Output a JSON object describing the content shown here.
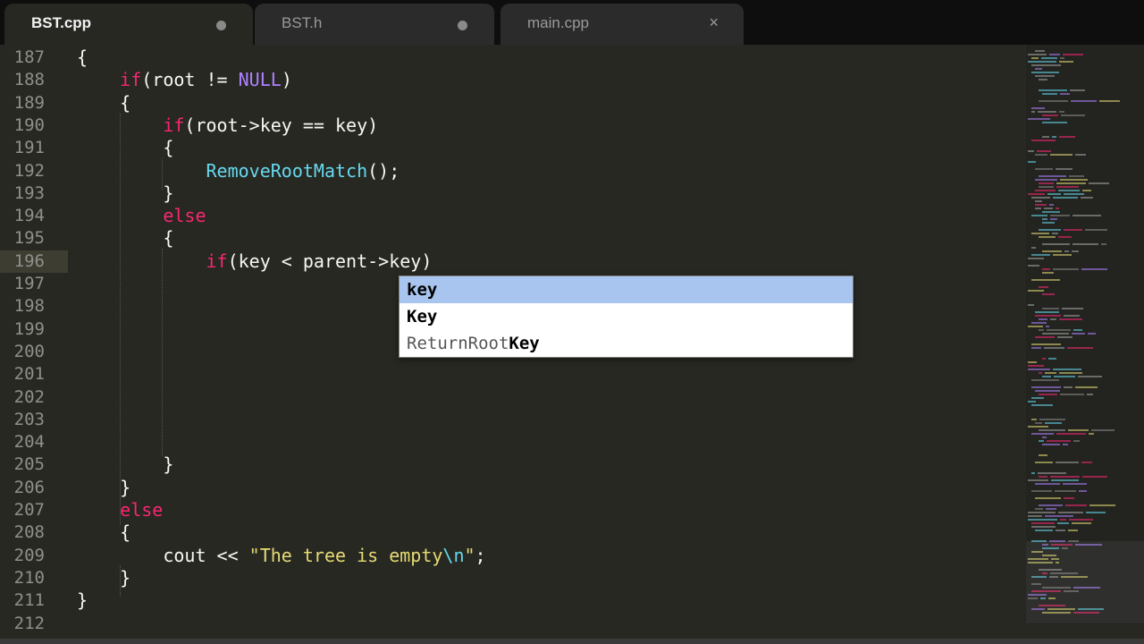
{
  "tabs": [
    {
      "label": "BST.cpp",
      "state": "modified",
      "active": true
    },
    {
      "label": "BST.h",
      "state": "modified",
      "active": false
    },
    {
      "label": "main.cpp",
      "state": "close",
      "active": false
    }
  ],
  "icons": {
    "modified_dot": "modified-dot-icon",
    "close": "close-icon"
  },
  "close_glyph": "×",
  "colors": {
    "background": "#272822",
    "keyword": "#f92672",
    "constant": "#ae81ff",
    "function": "#66d9ef",
    "string": "#e6db74",
    "text": "#f8f8f2",
    "selection": "#a8c5f0"
  },
  "editor": {
    "current_line": "196",
    "lines": [
      {
        "num": "187",
        "parts": [
          [
            "{",
            ""
          ]
        ]
      },
      {
        "num": "188",
        "parts": [
          [
            "    ",
            ""
          ],
          [
            "if",
            "kw"
          ],
          [
            "(root != ",
            ""
          ],
          [
            "NULL",
            "const"
          ],
          [
            ")",
            ""
          ]
        ]
      },
      {
        "num": "189",
        "parts": [
          [
            "    {",
            ""
          ]
        ]
      },
      {
        "num": "190",
        "parts": [
          [
            "        ",
            ""
          ],
          [
            "if",
            "kw"
          ],
          [
            "(root->key == key)",
            ""
          ]
        ]
      },
      {
        "num": "191",
        "parts": [
          [
            "        {",
            ""
          ]
        ]
      },
      {
        "num": "192",
        "parts": [
          [
            "            ",
            ""
          ],
          [
            "RemoveRootMatch",
            "fn"
          ],
          [
            "();",
            ""
          ]
        ]
      },
      {
        "num": "193",
        "parts": [
          [
            "        }",
            ""
          ]
        ]
      },
      {
        "num": "194",
        "parts": [
          [
            "        ",
            ""
          ],
          [
            "else",
            "kw"
          ]
        ]
      },
      {
        "num": "195",
        "parts": [
          [
            "        {",
            ""
          ]
        ]
      },
      {
        "num": "196",
        "parts": [
          [
            "            ",
            ""
          ],
          [
            "if",
            "kw"
          ],
          [
            "(key < parent->key)",
            ""
          ]
        ]
      },
      {
        "num": "197",
        "parts": []
      },
      {
        "num": "198",
        "parts": []
      },
      {
        "num": "199",
        "parts": []
      },
      {
        "num": "200",
        "parts": []
      },
      {
        "num": "201",
        "parts": []
      },
      {
        "num": "202",
        "parts": []
      },
      {
        "num": "203",
        "parts": []
      },
      {
        "num": "204",
        "parts": []
      },
      {
        "num": "205",
        "parts": [
          [
            "        }",
            ""
          ]
        ]
      },
      {
        "num": "206",
        "parts": [
          [
            "    }",
            ""
          ]
        ]
      },
      {
        "num": "207",
        "parts": [
          [
            "    ",
            ""
          ],
          [
            "else",
            "kw"
          ]
        ]
      },
      {
        "num": "208",
        "parts": [
          [
            "    {",
            ""
          ]
        ]
      },
      {
        "num": "209",
        "parts": [
          [
            "        cout << ",
            ""
          ],
          [
            "\"The tree is empty",
            "str"
          ],
          [
            "\\n",
            "fn"
          ],
          [
            "\"",
            "str"
          ],
          [
            ";",
            ""
          ]
        ]
      },
      {
        "num": "210",
        "parts": [
          [
            "    }",
            ""
          ]
        ]
      },
      {
        "num": "211",
        "parts": [
          [
            "}",
            ""
          ]
        ]
      },
      {
        "num": "212",
        "parts": []
      }
    ]
  },
  "autocomplete": {
    "items": [
      {
        "prefix": "",
        "match": "key",
        "selected": true
      },
      {
        "prefix": "",
        "match": "Key",
        "selected": false
      },
      {
        "prefix": "ReturnRoot",
        "match": "Key",
        "selected": false
      }
    ]
  }
}
